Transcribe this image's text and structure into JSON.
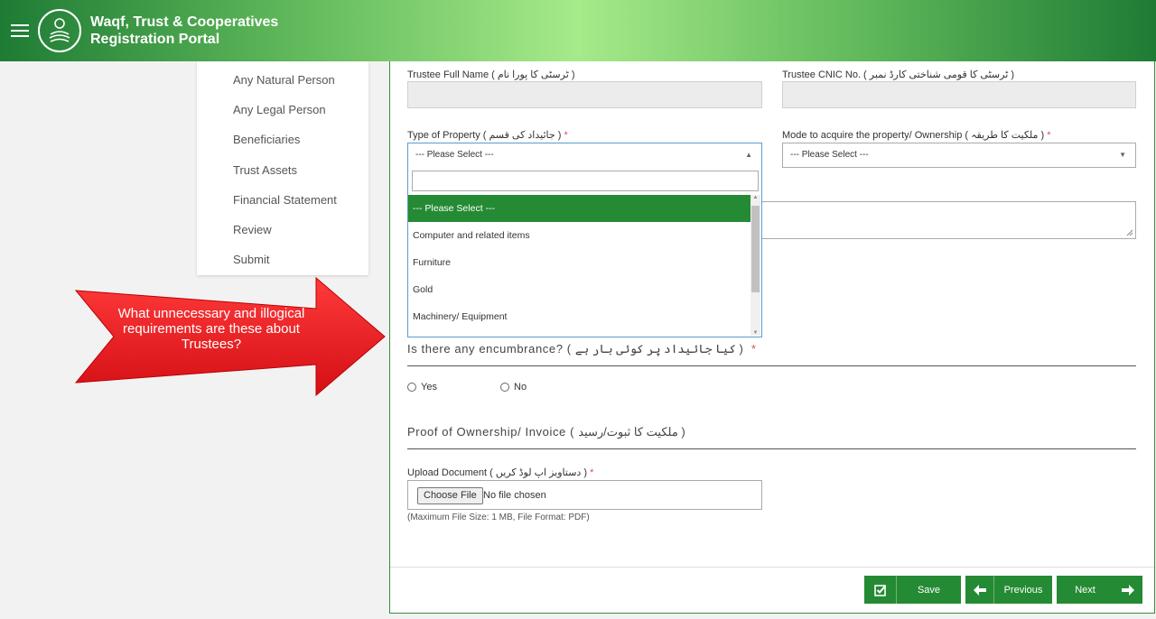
{
  "header": {
    "title_line1": "Waqf, Trust & Cooperatives",
    "title_line2": "Registration Portal"
  },
  "sidebar": {
    "items": [
      {
        "label": "Any Natural Person"
      },
      {
        "label": "Any Legal Person"
      },
      {
        "label": "Beneficiaries"
      },
      {
        "label": "Trust Assets"
      },
      {
        "label": "Financial Statement"
      },
      {
        "label": "Review"
      },
      {
        "label": "Submit"
      }
    ]
  },
  "callout": {
    "text": "What unnecessary and illogical requirements are these about Trustees?",
    "color": "#e8151b"
  },
  "form": {
    "trustee_name_label": "Trustee Full Name ( ٹرسٹی کا پورا نام )",
    "trustee_cnic_label": "Trustee CNIC No. ( ٹرسٹی کا قومی شناختی کارڈ نمبر )",
    "property_type_label": "Type of Property ( جائیداد کی قسم )",
    "property_type_value": "--- Please Select ---",
    "mode_label": "Mode to acquire the property/ Ownership ( ملکیت کا طریقہ )",
    "mode_value": "--- Please Select ---",
    "required_mark": "*",
    "dropdown_options": [
      "--- Please Select ---",
      "Computer and related items",
      "Furniture",
      "Gold",
      "Machinery/ Equipment"
    ],
    "encumbrance_label": "Is there any encumbrance? ( کیا جائیداد پر کوئی بار ہے )",
    "radio_yes": "Yes",
    "radio_no": "No",
    "proof_title": "Proof of Ownership/ Invoice ( ملکیت کا ثبوت/رسید )",
    "upload_label": "Upload Document ( دستاویز اپ لوڈ کریں )",
    "choose_file": "Choose File",
    "no_file": "No file chosen",
    "file_hint": "(Maximum File Size: 1 MB, File Format: PDF)"
  },
  "buttons": {
    "save": "Save",
    "previous": "Previous",
    "next": "Next"
  },
  "colors": {
    "brand_green": "#258a34",
    "accent_red": "#e8151b"
  }
}
